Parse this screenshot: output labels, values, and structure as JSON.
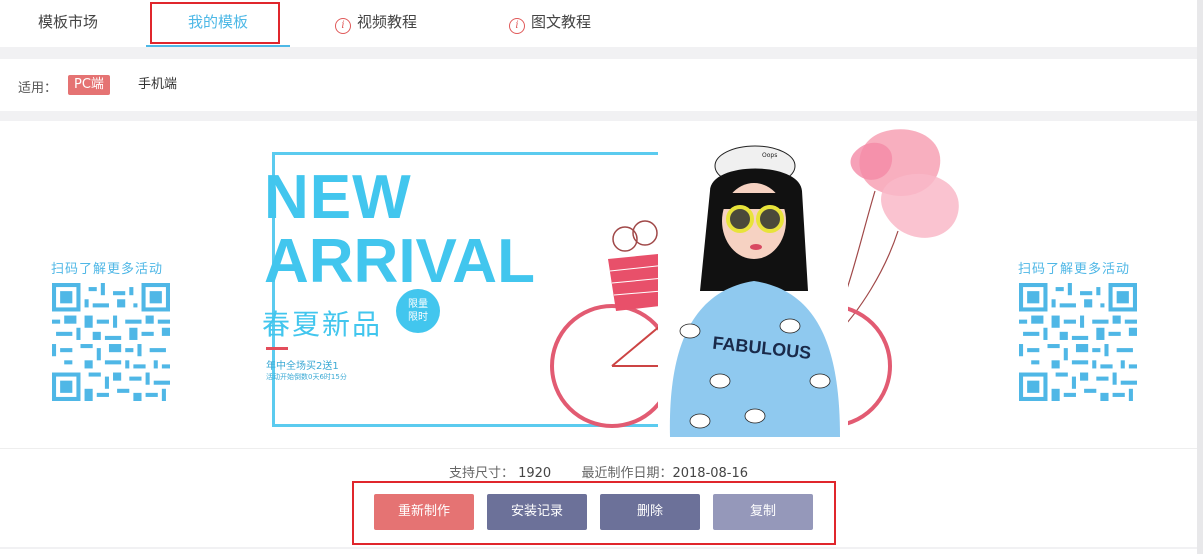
{
  "tabs": [
    {
      "label": "模板市场",
      "active": false,
      "icon": ""
    },
    {
      "label": "我的模板",
      "active": true,
      "icon": ""
    },
    {
      "label": "视频教程",
      "active": false,
      "icon": "info-icon"
    },
    {
      "label": "图文教程",
      "active": false,
      "icon": "info-icon"
    }
  ],
  "filter": {
    "label": "适用：",
    "options": [
      {
        "label": "PC端",
        "selected": true
      },
      {
        "label": "手机端",
        "selected": false
      }
    ]
  },
  "banner": {
    "headline_line1": "NEW",
    "headline_line2": "ARRIVAL",
    "subtitle": "春夏新品",
    "badge_line1": "限量",
    "badge_line2": "限时",
    "promo_line1": "年中全场买2送1",
    "promo_line2": "活动开始倒数0天6时15分",
    "qr_left_caption": "扫码了解更多活动",
    "qr_right_caption": "扫码了解更多活动",
    "shirt_text": "FABULOUS",
    "cap_text": "Oops"
  },
  "template": {
    "size_label": "支持尺寸：",
    "size_value": "1920",
    "date_label": "最近制作日期：",
    "date_value": "2018-08-16"
  },
  "actions": {
    "remake": "重新制作",
    "install_log": "安装记录",
    "delete": "删除",
    "copy": "复制"
  },
  "colors": {
    "accent": "#4db8e6",
    "highlight_box": "#e0262c",
    "remake_btn": "#e57373",
    "install_btn": "#6c7199",
    "delete_btn": "#6c7199",
    "copy_btn": "#9598ba"
  }
}
